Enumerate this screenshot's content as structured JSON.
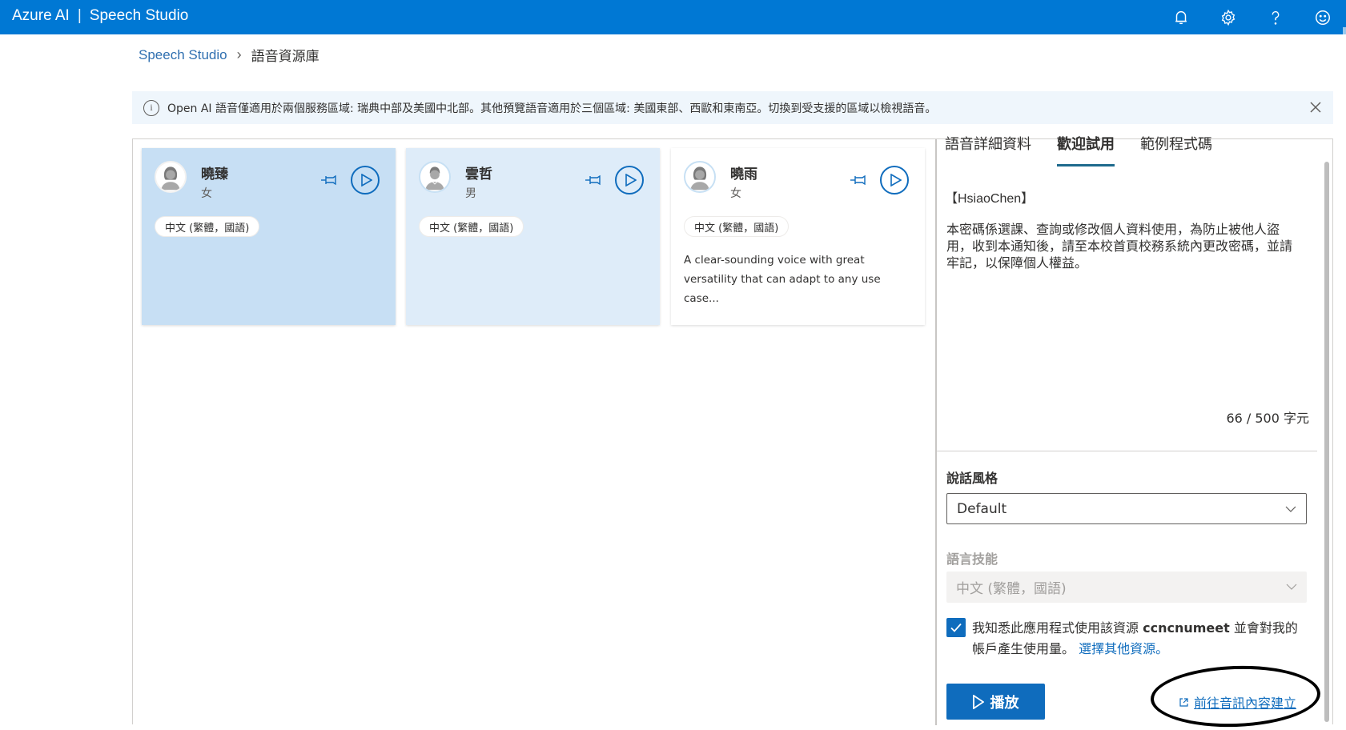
{
  "header": {
    "brand": "Azure AI",
    "separator": "|",
    "product": "Speech Studio",
    "icons": [
      "bell-icon",
      "gear-icon",
      "help-icon",
      "feedback-smiley-icon"
    ]
  },
  "breadcrumb": {
    "root": "Speech Studio",
    "current": "語音資源庫"
  },
  "banner": {
    "icon": "info-icon",
    "info_glyph": "i",
    "text": "Open AI 語音僅適用於兩個服務區域: 瑞典中部及美國中北部。其他預覽語音適用於三個區域: 美國東部、西歐和東南亞。切換到受支援的區域以檢視語音。"
  },
  "voices": [
    {
      "name": "曉臻",
      "gender": "女",
      "locale": "中文 (繁體，國語)",
      "description": "",
      "state": "selected"
    },
    {
      "name": "雲哲",
      "gender": "男",
      "locale": "中文 (繁體，國語)",
      "description": "",
      "state": "hover"
    },
    {
      "name": "曉雨",
      "gender": "女",
      "locale": "中文 (繁體，國語)",
      "description": "A clear-sounding voice with great versatility that can adapt to any use case...",
      "state": "default"
    }
  ],
  "panel": {
    "tabs": [
      {
        "label": "語音詳細資料",
        "active": false
      },
      {
        "label": "歡迎試用",
        "active": true
      },
      {
        "label": "範例程式碼",
        "active": false
      }
    ],
    "sample_title": "【HsiaoChen】",
    "sample_text": " 本密碼係選課、查詢或修改個人資料使用，為防止被他人盜用，收到本通知後，請至本校首頁校務系統內更改密碼，並請牢記，以保障個人權益。",
    "char_count": "66 / 500 字元",
    "style_label": "說話風格",
    "style_value": "Default",
    "language_label": "語言技能",
    "language_value": "中文 (繁體，國語)",
    "consent_checked": true,
    "consent_text_before": "我知悉此應用程式使用該資源",
    "consent_resource": "ccncnumeet",
    "consent_text_after": "並會對我的帳戶產生使用量。",
    "choose_resource_link": "選擇其他資源。",
    "play_button": "播放",
    "audio_content_link": "前往音訊內容建立"
  }
}
